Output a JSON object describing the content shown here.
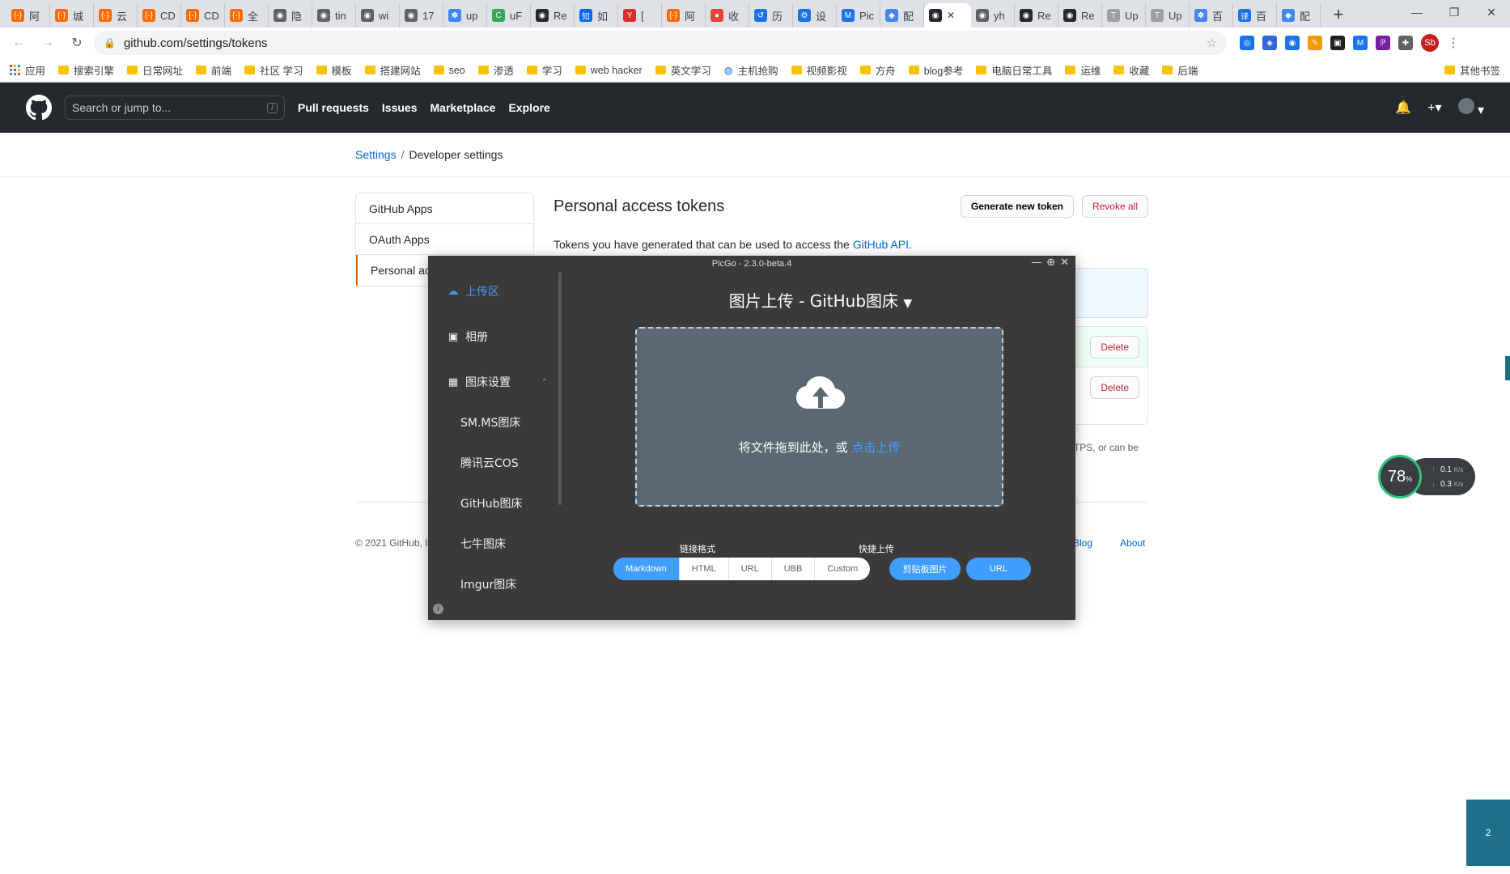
{
  "browser": {
    "tabs": [
      {
        "label": "阿",
        "fav": "{-}",
        "color": "#ff6a00"
      },
      {
        "label": "城",
        "fav": "{-}",
        "color": "#ff6a00"
      },
      {
        "label": "云",
        "fav": "{-}",
        "color": "#ff6a00"
      },
      {
        "label": "CD",
        "fav": "{-}",
        "color": "#ff6a00"
      },
      {
        "label": "CD",
        "fav": "{-}",
        "color": "#ff6a00"
      },
      {
        "label": "全",
        "fav": "{-}",
        "color": "#ff6a00"
      },
      {
        "label": "隐",
        "fav": "◉",
        "color": "#5f6368"
      },
      {
        "label": "tin",
        "fav": "◉",
        "color": "#5f6368"
      },
      {
        "label": "wi",
        "fav": "◉",
        "color": "#5f6368"
      },
      {
        "label": "17",
        "fav": "◉",
        "color": "#5f6368"
      },
      {
        "label": "up",
        "fav": "✽",
        "color": "#4285f4"
      },
      {
        "label": "uF",
        "fav": "C",
        "color": "#34a853"
      },
      {
        "label": "Re",
        "fav": "◉",
        "color": "#24292e"
      },
      {
        "label": "如",
        "fav": "知",
        "color": "#0066ff"
      },
      {
        "label": "[",
        "fav": "Y",
        "color": "#d93025"
      },
      {
        "label": "阿",
        "fav": "{-}",
        "color": "#ff6a00"
      },
      {
        "label": "收",
        "fav": "●",
        "color": "#ea4335"
      },
      {
        "label": "历",
        "fav": "↺",
        "color": "#1a73e8"
      },
      {
        "label": "设",
        "fav": "⚙",
        "color": "#1a73e8"
      },
      {
        "label": "Pic",
        "fav": "M",
        "color": "#1a73e8"
      },
      {
        "label": "配",
        "fav": "◆",
        "color": "#4285f4"
      },
      {
        "label": "",
        "fav": "◉",
        "color": "#24292e",
        "active": true
      },
      {
        "label": "yh",
        "fav": "◉",
        "color": "#5f6368"
      },
      {
        "label": "Re",
        "fav": "◉",
        "color": "#24292e"
      },
      {
        "label": "Re",
        "fav": "◉",
        "color": "#24292e"
      },
      {
        "label": "Up",
        "fav": "T",
        "color": "#9aa0a6"
      },
      {
        "label": "Up",
        "fav": "T",
        "color": "#9aa0a6"
      },
      {
        "label": "百",
        "fav": "✽",
        "color": "#4285f4"
      },
      {
        "label": "百",
        "fav": "译",
        "color": "#1a73e8"
      },
      {
        "label": "配",
        "fav": "◆",
        "color": "#4285f4"
      }
    ],
    "new_tab": "+",
    "window_controls": {
      "minimize": "—",
      "maximize": "❐",
      "close": "✕"
    },
    "url": "github.com/settings/tokens",
    "profile_initials": "Sb",
    "extensions": [
      {
        "glyph": "◎",
        "color": "#1a73e8"
      },
      {
        "glyph": "◈",
        "color": "#3367d6"
      },
      {
        "glyph": "◉",
        "color": "#1a73e8"
      },
      {
        "glyph": "✎",
        "color": "#f29900"
      },
      {
        "glyph": "▣",
        "color": "#202124"
      },
      {
        "glyph": "M",
        "color": "#1a73e8"
      },
      {
        "glyph": "ℙ",
        "color": "#7b1fa2"
      },
      {
        "glyph": "✚",
        "color": "#5f6368"
      }
    ],
    "bookmarks": [
      {
        "label": "应用",
        "apps": true
      },
      {
        "label": "搜索引擎"
      },
      {
        "label": "日常网址"
      },
      {
        "label": "前端"
      },
      {
        "label": "社区 学习"
      },
      {
        "label": "模板"
      },
      {
        "label": "搭建网站"
      },
      {
        "label": "seo"
      },
      {
        "label": "渗透"
      },
      {
        "label": "学习"
      },
      {
        "label": "web hacker"
      },
      {
        "label": "英文学习"
      },
      {
        "label": "主机抢购",
        "globe": true
      },
      {
        "label": "视频影视"
      },
      {
        "label": "方舟"
      },
      {
        "label": "blog参考"
      },
      {
        "label": "电脑日常工具"
      },
      {
        "label": "运维"
      },
      {
        "label": "收藏"
      },
      {
        "label": "后端"
      }
    ],
    "other_bookmarks": "其他书签"
  },
  "github": {
    "search_placeholder": "Search or jump to...",
    "search_shortcut": "/",
    "nav": [
      "Pull requests",
      "Issues",
      "Marketplace",
      "Explore"
    ],
    "breadcrumb": {
      "parent": "Settings",
      "separator": "/",
      "current": "Developer settings"
    },
    "sidebar": [
      "GitHub Apps",
      "OAuth Apps",
      "Personal access tokens"
    ],
    "page_title": "Personal access tokens",
    "generate_button": "Generate new token",
    "revoke_button": "Revoke all",
    "description_prefix": "Tokens you have generated that can be used to access the ",
    "description_link": "GitHub API",
    "description_suffix": ".",
    "delete_label": "Delete",
    "note_fragment": "TPS, or can be",
    "footer_copy": "© 2021 GitHub, I",
    "footer_links": [
      "Blog",
      "About"
    ]
  },
  "speed_widget": {
    "percent": "78",
    "percent_unit": "%",
    "upload": "0.1",
    "download": "0.3",
    "unit": "K/s"
  },
  "taskbar_hint": "2",
  "picgo": {
    "title": "PicGo - 2.3.0-beta.4",
    "menu": {
      "upload": "上传区",
      "album": "相册",
      "settings": "图床设置"
    },
    "hosts": [
      "SM.MS图床",
      "腾讯云COS",
      "GitHub图床",
      "七牛图床",
      "Imgur图床"
    ],
    "heading": "图片上传 - GitHub图床",
    "drop_text": "将文件拖到此处，或 ",
    "drop_link": "点击上传",
    "link_format_label": "链接格式",
    "quick_upload_label": "快捷上传",
    "formats": [
      "Markdown",
      "HTML",
      "URL",
      "UBB",
      "Custom"
    ],
    "selected_format": "Markdown",
    "clipboard_button": "剪贴板图片",
    "url_button": "URL",
    "info_glyph": "i"
  }
}
